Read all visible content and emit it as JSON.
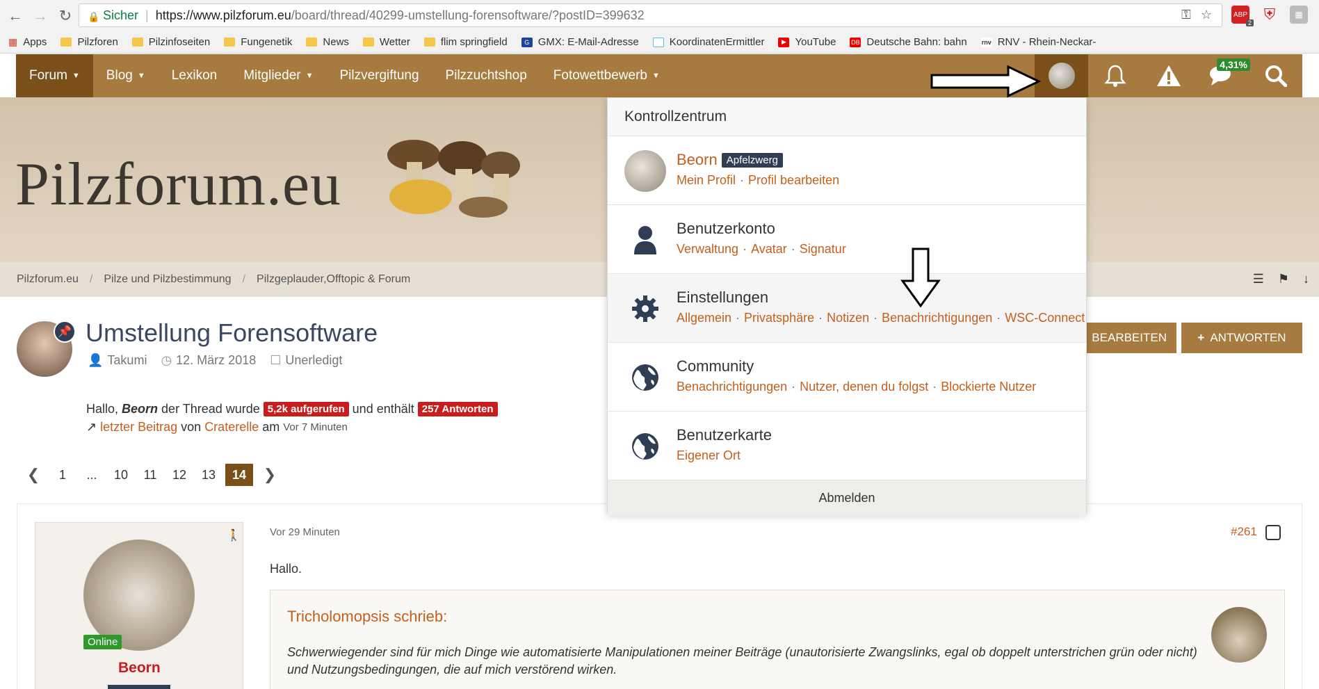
{
  "browser": {
    "secure_label": "Sicher",
    "url_scheme_host": "https://www.pilzforum.eu",
    "url_path": "/board/thread/40299-umstellung-forensoftware/?postID=399632",
    "bookmarks": [
      "Apps",
      "Pilzforen",
      "Pilzinfoseiten",
      "Fungenetik",
      "News",
      "Wetter",
      "flim springfield",
      "GMX: E-Mail-Adresse",
      "KoordinatenErmittler",
      "YouTube",
      "Deutsche Bahn: bahn",
      "RNV - Rhein-Neckar-"
    ],
    "ext_abp_count": "2",
    "ext_abp_label": "ABP"
  },
  "nav": {
    "items": [
      "Forum",
      "Blog",
      "Lexikon",
      "Mitglieder",
      "Pilzvergiftung",
      "Pilzzuchtshop",
      "Fotowettbewerb"
    ],
    "percent_badge": "4,31%"
  },
  "banner": {
    "logo": "Pilzforum.eu"
  },
  "breadcrumb": [
    "Pilzforum.eu",
    "Pilze und Pilzbestimmung",
    "Pilzgeplauder,Offtopic & Forum"
  ],
  "thread": {
    "title": "Umstellung Forensoftware",
    "author": "Takumi",
    "date": "12. März 2018",
    "status": "Unerledigt",
    "edit_label": "BEARBEITEN",
    "reply_label": "ANTWORTEN",
    "hello_prefix": "Hallo,",
    "hello_user": "Beorn",
    "hello_mid": "der Thread wurde",
    "views_badge": "5,2k aufgerufen",
    "hello_and": "und enthält",
    "replies_badge": "257 Antworten",
    "last_post_label": "letzter Beitrag",
    "last_post_from": "von",
    "last_post_user": "Craterelle",
    "last_post_at": "am",
    "last_post_time": "Vor 7 Minuten"
  },
  "pagination": {
    "pages": [
      "1",
      "...",
      "10",
      "11",
      "12",
      "13"
    ],
    "current": "14"
  },
  "post": {
    "online": "Online",
    "author": "Beorn",
    "time": "Vor 29 Minuten",
    "number": "#261",
    "greeting": "Hallo.",
    "quote_author": "Tricholomopsis schrieb:",
    "quote_text": "Schwerwiegender sind für mich Dinge wie automatisierte Manipulationen meiner Beiträge (unautorisierte Zwangslinks, egal ob doppelt unterstrichen grün oder nicht) und Nutzungsbedingungen, die auf mich verstörend wirken."
  },
  "panel": {
    "title": "Kontrollzentrum",
    "user_name": "Beorn",
    "user_rank": "Apfelzwerg",
    "user_links": [
      "Mein Profil",
      "Profil bearbeiten"
    ],
    "account_title": "Benutzerkonto",
    "account_links": [
      "Verwaltung",
      "Avatar",
      "Signatur"
    ],
    "settings_title": "Einstellungen",
    "settings_links": [
      "Allgemein",
      "Privatsphäre",
      "Notizen",
      "Benachrichtigungen",
      "WSC-Connect"
    ],
    "community_title": "Community",
    "community_links": [
      "Benachrichtigungen",
      "Nutzer, denen du folgst",
      "Blockierte Nutzer"
    ],
    "map_title": "Benutzerkarte",
    "map_links": [
      "Eigener Ort"
    ],
    "logout": "Abmelden"
  },
  "colors": {
    "nav_bg": "#a77a3f",
    "nav_active": "#7a4f1a",
    "link_orange": "#c5601c",
    "badge_red": "#c91d1d",
    "dark_blue": "#2f3e55"
  }
}
